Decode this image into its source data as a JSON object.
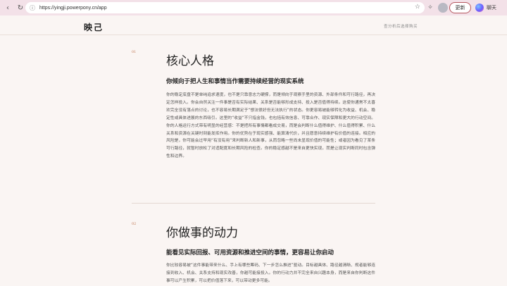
{
  "browser": {
    "url": "https://yingji.powerpony.cn/app",
    "update_label": "更新",
    "chat_label": "聊天"
  },
  "header": {
    "logo": "映己",
    "link": "查分析后选择购买"
  },
  "sections": [
    {
      "num": "01",
      "title": "核心人格",
      "subtitle": "你倾向于把人生和事情当作需要持续经营的现实系统",
      "body": "你的稳定底盘不是单纯追求速度，也不是只靠意志力硬撑，而是倾向于观察手里的资源、外部条件和可行路径，再决定怎样投入。你会自然关注一件事是否有实际结果、关系是否能够形成支持、投入是否值得持续。这使你通常不太喜欢完全没有落点的讨论，也不容易长期满足于“想法很好但无法执行”的状态。你更容易被能够转化为收益、机会、稳定性或具体进展的东西吸引。这里的“收益”不只指金钱，也包括有效信息、可靠合作、现实保障和更大的行动空间。你的人格运行方式带有明显的经营感：不是把所有事情都看成交易，而是会判断什么值得维护、什么值得积累、什么关系和资源在关键时刻能发挥作用。你的优势在于现实感强、能算清代价，并且愿意持续维护有价值的连接。相应的风险是，你可能会过早用“有没有用”来判断新人和新事，从而忽略一些尚未显现价值的可能性；或者因为看见了某条可行路径，就暂时放松了对适配度和长期风险的检查。你的稳定感越不是来自更快实现，而是让现实判断同时包含弹性和边界。"
    },
    {
      "num": "02",
      "title": "你做事的动力",
      "subtitle": "能看见实际回报、可用资源和推进空间的事情，更容易让你启动",
      "body": "你比较容易被“这件事能带来什么、手上有哪些筹码、下一步怎么推进”驱动。目标越具体、路径越清晰、规者能够连接到收入、机会、关系支持和现实改善，你越可能接投入。你的行动力并不完全来自兴趣本身，而是来自你判断这件事可以产生积累，可以把价值落下来，可以带动更多可能。"
    }
  ]
}
